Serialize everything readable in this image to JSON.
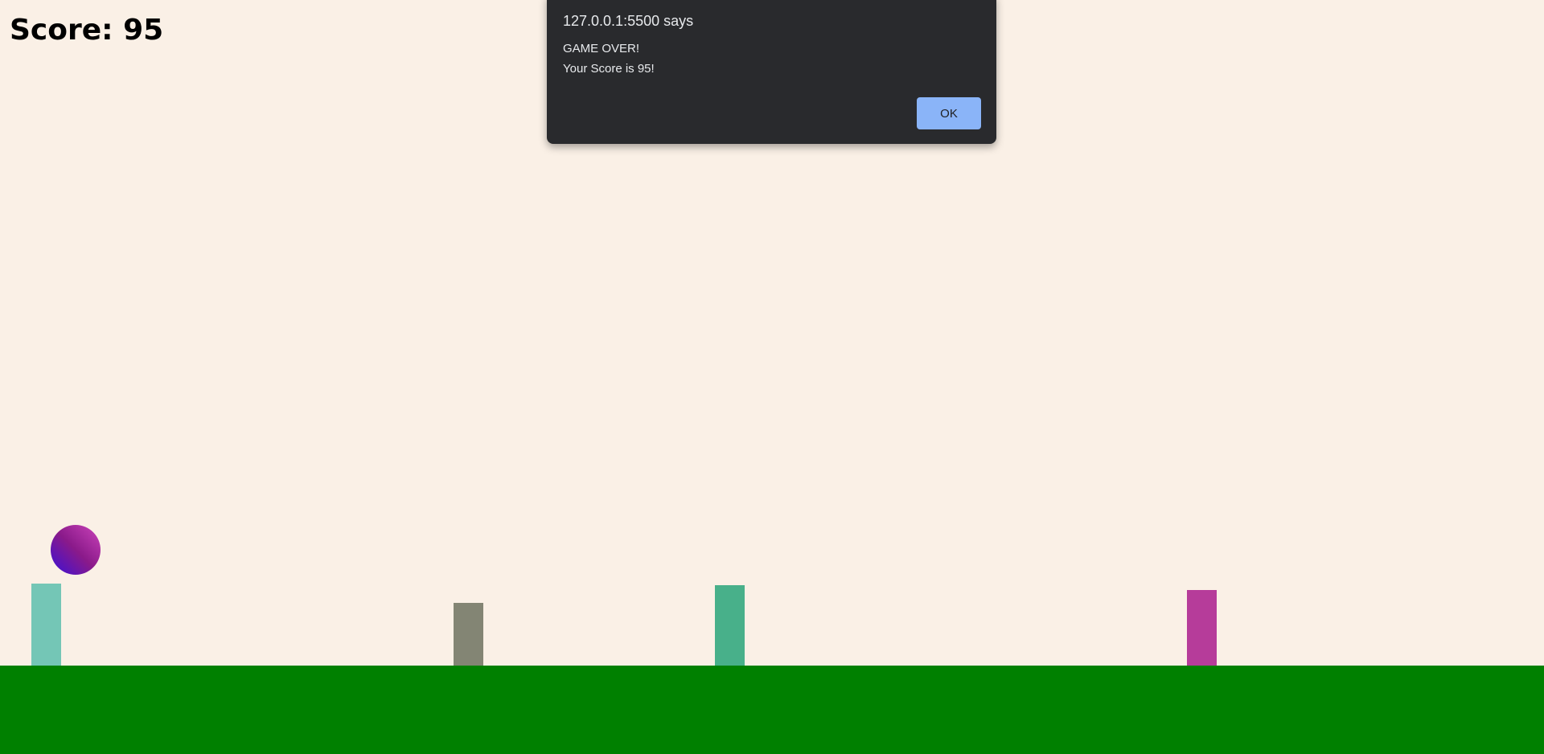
{
  "game": {
    "score_text": "Score: 95",
    "colors": {
      "background": "#faf0e6",
      "ground": "#008000",
      "ball_gradient": [
        "#cc44bb",
        "#3a10d8"
      ],
      "obstacles": [
        "#74c6b6",
        "#838574",
        "#48b08a",
        "#b63c9a"
      ]
    }
  },
  "dialog": {
    "origin": "127.0.0.1:5500 says",
    "message_line_1": "GAME OVER!",
    "message_line_2": "Your Score is 95!",
    "ok_label": "OK",
    "colors": {
      "background": "#292a2d",
      "button": "#8ab4f8"
    }
  }
}
